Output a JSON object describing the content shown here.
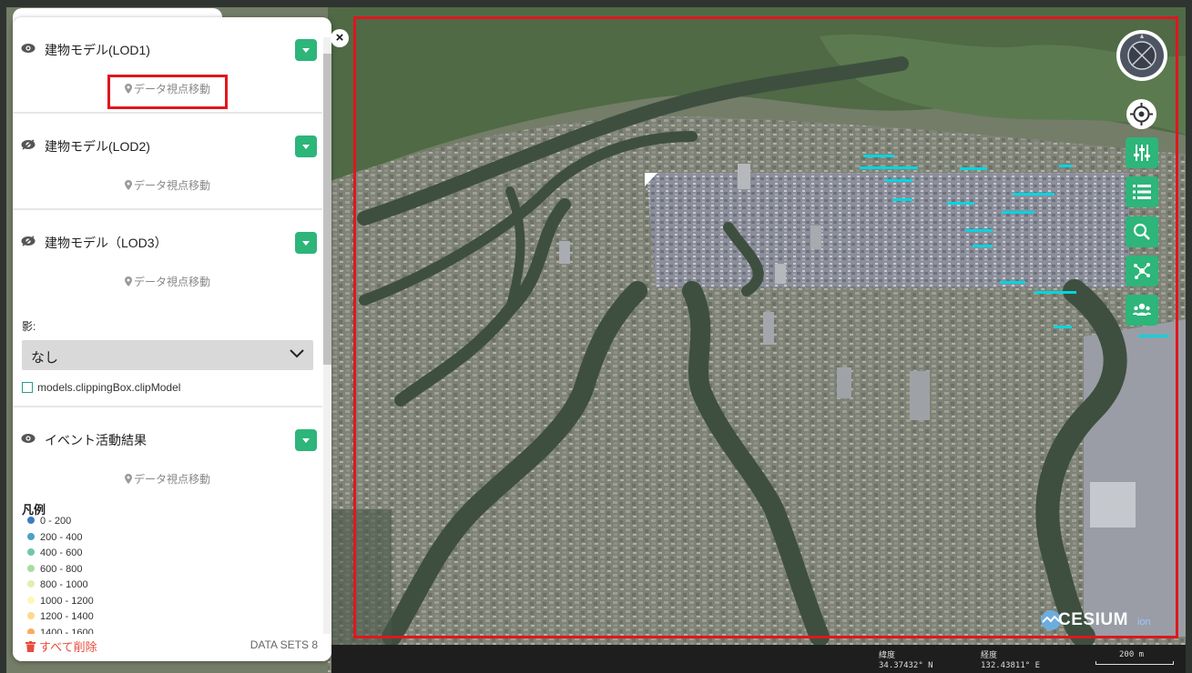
{
  "panel": {
    "layers": [
      {
        "title": "建物モデル(LOD1)",
        "move_label": "データ視点移動",
        "visible": true
      },
      {
        "title": "建物モデル(LOD2)",
        "move_label": "データ視点移動",
        "visible": false
      },
      {
        "title": "建物モデル（LOD3）",
        "move_label": "データ視点移動",
        "visible": false
      }
    ],
    "shadow_label": "影:",
    "shadow_value": "なし",
    "clip_label": "models.clippingBox.clipModel",
    "event_layer": {
      "title": "イベント活動結果",
      "move_label": "データ視点移動"
    },
    "legend_title": "凡例",
    "legend": [
      {
        "label": "0 - 200",
        "color": "#3a7dc0"
      },
      {
        "label": "200 - 400",
        "color": "#4aa3c2"
      },
      {
        "label": "400 - 600",
        "color": "#71c6a6"
      },
      {
        "label": "600 - 800",
        "color": "#a8dca2"
      },
      {
        "label": "800 - 1000",
        "color": "#dff0b0"
      },
      {
        "label": "1000 - 1200",
        "color": "#fef7b7"
      },
      {
        "label": "1200 - 1400",
        "color": "#fdd98a"
      },
      {
        "label": "1400 - 1600",
        "color": "#f8ad5e"
      }
    ],
    "delete_all": "すべて削除",
    "datasets": "DATA SETS 8"
  },
  "close_label": "×",
  "toolbar": {
    "icons": [
      "compass-icon",
      "locate-icon",
      "settings-sliders-icon",
      "list-icon",
      "search-icon",
      "share-network-icon",
      "users-icon"
    ]
  },
  "status": {
    "lat_label": "緯度",
    "lat_value": "34.37432° N",
    "lon_label": "経度",
    "lon_value": "132.43811° E",
    "scale": "200 m"
  },
  "logo": {
    "brand": "CESIUM",
    "suffix": "ion"
  },
  "colors": {
    "accent": "#2db57a",
    "highlight": "#e0161e"
  }
}
